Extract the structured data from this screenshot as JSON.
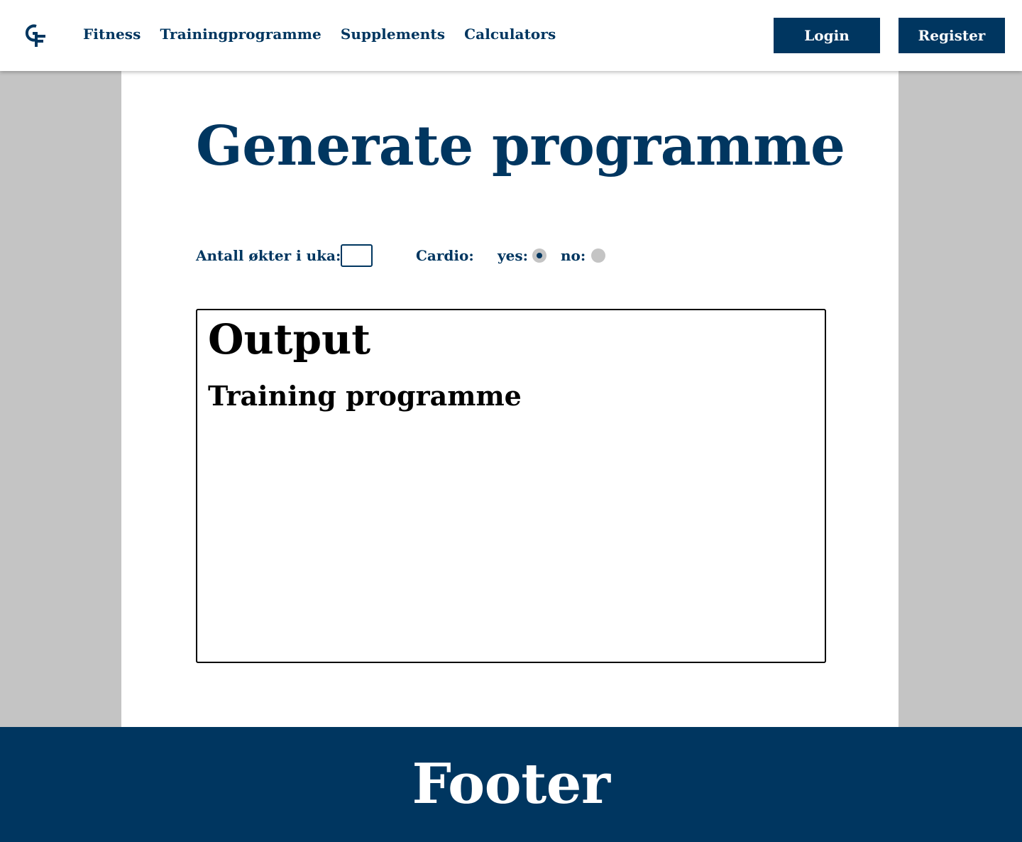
{
  "header": {
    "logo_text": "GF",
    "nav": [
      "Fitness",
      "Trainingprogramme",
      "Supplements",
      "Calculators"
    ],
    "login_label": "Login",
    "register_label": "Register"
  },
  "main": {
    "title": "Generate programme",
    "form": {
      "sessions_label": "Antall økter i uka:",
      "sessions_value": "",
      "cardio_label": "Cardio:",
      "yes_label": "yes:",
      "no_label": "no:",
      "cardio_selected": "yes"
    },
    "output": {
      "heading": "Output",
      "subheading": "Training programme"
    }
  },
  "footer": {
    "title": "Footer"
  },
  "colors": {
    "primary": "#003660",
    "background": "#c4c4c4",
    "panel": "#ffffff"
  }
}
